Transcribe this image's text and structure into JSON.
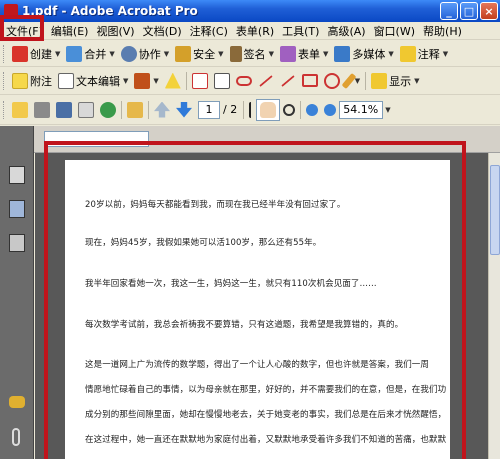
{
  "window": {
    "title": "1.pdf - Adobe Acrobat Pro",
    "min_label": "_",
    "max_label": "□",
    "close_label": "×"
  },
  "menu": [
    "文件(F)",
    "编辑(E)",
    "视图(V)",
    "文档(D)",
    "注释(C)",
    "表单(R)",
    "工具(T)",
    "高级(A)",
    "窗口(W)",
    "帮助(H)"
  ],
  "toolbar1": {
    "create": "创建",
    "combine": "合并",
    "collaborate": "协作",
    "secure": "安全",
    "sign": "签名",
    "forms": "表单",
    "multimedia": "多媒体",
    "comment": "注释"
  },
  "toolbar2": {
    "sticky_note": "附注",
    "text_edit": "文本编辑",
    "show": "显示"
  },
  "toolbar3": {
    "page_current": "1",
    "page_total": "/ 2",
    "zoom": "54.1%"
  },
  "document": {
    "lines": [
      "20岁以前，妈妈每天都能看到我，而现在我已经半年没有回过家了。",
      "现在，妈妈45岁，我假如果她可以活100岁，那么还有55年。",
      "我半年回家看她一次，我这一生，妈妈这一生，就只有110次机会见面了……",
      "每次数学考试前，我总会祈祷我不要算错，只有这道题，我希望是我算错的，真的。",
      "这是一道网上广为流传的数学题，得出了一个让人心酸的数字，但也许就是答案，我们一周",
      "情愿地忙碌着自己的事情，以为母亲就在那里，好好的，并不需要我们的在意，但是，在我们功",
      "成分别的那些间隙里面，她却在慢慢地老去，关于她变老的事实，我们总是在后来才恍然醒悟，",
      "在这过程中，她一直还在默默地为家庭付出着，又默默地承受着许多我们不知道的苦痛，也默默"
    ]
  },
  "colors": {
    "highlight": "#c0141c",
    "titlebar": "#0a48c4"
  }
}
